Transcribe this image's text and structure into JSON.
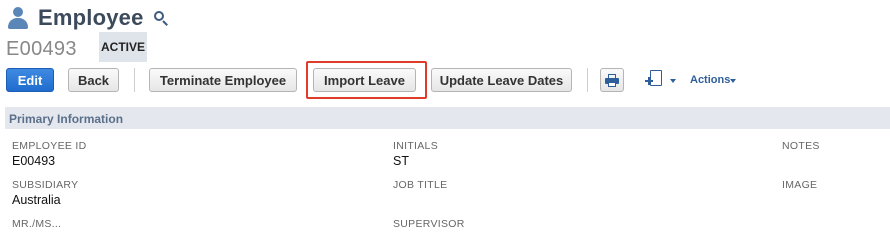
{
  "header": {
    "title": "Employee",
    "record_id": "E00493",
    "status": "ACTIVE"
  },
  "toolbar": {
    "edit_label": "Edit",
    "back_label": "Back",
    "terminate_label": "Terminate Employee",
    "import_leave_label": "Import Leave",
    "update_leave_dates_label": "Update Leave Dates",
    "actions_label": "Actions",
    "icons": [
      "print-icon",
      "new-document-icon"
    ]
  },
  "section": {
    "title": "Primary Information"
  },
  "fields": {
    "employee_id": {
      "label": "EMPLOYEE ID",
      "value": "E00493"
    },
    "initials": {
      "label": "INITIALS",
      "value": "ST"
    },
    "notes": {
      "label": "NOTES"
    },
    "subsidiary": {
      "label": "SUBSIDIARY",
      "value": "Australia"
    },
    "job_title": {
      "label": "JOB TITLE"
    },
    "image": {
      "label": "IMAGE"
    },
    "mr_ms": {
      "label": "MR./MS..."
    },
    "supervisor": {
      "label": "SUPERVISOR"
    }
  },
  "colors": {
    "primary_button": "#2a7ad8",
    "highlight": "#e03c2a",
    "section_bg": "#e4e8ee",
    "link": "#2f5f9a"
  }
}
